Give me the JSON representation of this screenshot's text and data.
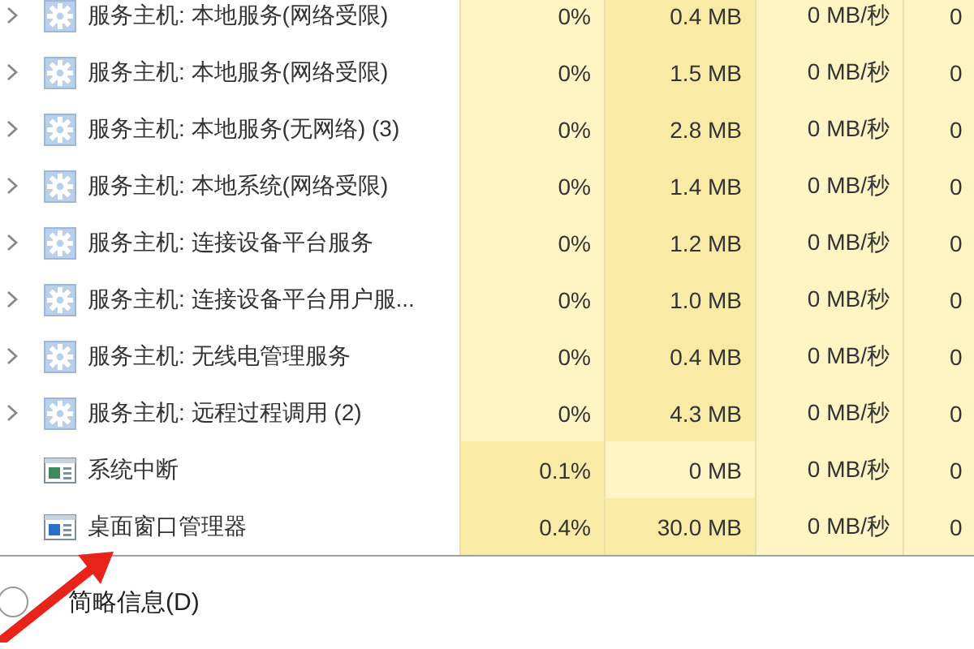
{
  "processes": [
    {
      "name": "服务主机: 本地服务(网络受限)",
      "kind": "service",
      "expandable": true,
      "cpu": {
        "text": "0%",
        "color": "#fff4c4"
      },
      "memory": {
        "text": "0.4 MB",
        "color": "#f9eba6"
      },
      "disk": {
        "text": "0 MB/秒",
        "color": "#fff4c4"
      },
      "column_5": {
        "text": "0",
        "color": "#fff4c4"
      }
    },
    {
      "name": "服务主机: 本地服务(网络受限)",
      "kind": "service",
      "expandable": true,
      "cpu": {
        "text": "0%",
        "color": "#fff4c4"
      },
      "memory": {
        "text": "1.5 MB",
        "color": "#f9eba6"
      },
      "disk": {
        "text": "0 MB/秒",
        "color": "#fff4c4"
      },
      "column_5": {
        "text": "0",
        "color": "#fff4c4"
      }
    },
    {
      "name": "服务主机: 本地服务(无网络) (3)",
      "kind": "service",
      "expandable": true,
      "cpu": {
        "text": "0%",
        "color": "#fff4c4"
      },
      "memory": {
        "text": "2.8 MB",
        "color": "#f9eba6"
      },
      "disk": {
        "text": "0 MB/秒",
        "color": "#fff4c4"
      },
      "column_5": {
        "text": "0",
        "color": "#fff4c4"
      }
    },
    {
      "name": "服务主机: 本地系统(网络受限)",
      "kind": "service",
      "expandable": true,
      "cpu": {
        "text": "0%",
        "color": "#fff4c4"
      },
      "memory": {
        "text": "1.4 MB",
        "color": "#f9eba6"
      },
      "disk": {
        "text": "0 MB/秒",
        "color": "#fff4c4"
      },
      "column_5": {
        "text": "0",
        "color": "#fff4c4"
      }
    },
    {
      "name": "服务主机: 连接设备平台服务",
      "kind": "service",
      "expandable": true,
      "cpu": {
        "text": "0%",
        "color": "#fff4c4"
      },
      "memory": {
        "text": "1.2 MB",
        "color": "#f9eba6"
      },
      "disk": {
        "text": "0 MB/秒",
        "color": "#fff4c4"
      },
      "column_5": {
        "text": "0",
        "color": "#fff4c4"
      }
    },
    {
      "name": "服务主机: 连接设备平台用户服...",
      "kind": "service",
      "expandable": true,
      "cpu": {
        "text": "0%",
        "color": "#fff4c4"
      },
      "memory": {
        "text": "1.0 MB",
        "color": "#f9eba6"
      },
      "disk": {
        "text": "0 MB/秒",
        "color": "#fff4c4"
      },
      "column_5": {
        "text": "0",
        "color": "#fff4c4"
      }
    },
    {
      "name": "服务主机: 无线电管理服务",
      "kind": "service",
      "expandable": true,
      "cpu": {
        "text": "0%",
        "color": "#fff4c4"
      },
      "memory": {
        "text": "0.4 MB",
        "color": "#f9eba6"
      },
      "disk": {
        "text": "0 MB/秒",
        "color": "#fff4c4"
      },
      "column_5": {
        "text": "0",
        "color": "#fff4c4"
      }
    },
    {
      "name": "服务主机: 远程过程调用 (2)",
      "kind": "service",
      "expandable": true,
      "cpu": {
        "text": "0%",
        "color": "#fff4c4"
      },
      "memory": {
        "text": "4.3 MB",
        "color": "#f9eba6"
      },
      "disk": {
        "text": "0 MB/秒",
        "color": "#fff4c4"
      },
      "column_5": {
        "text": "0",
        "color": "#fff4c4"
      }
    },
    {
      "name": "系统中断",
      "kind": "system",
      "expandable": false,
      "cpu": {
        "text": "0.1%",
        "color": "#f9eba6"
      },
      "memory": {
        "text": "0 MB",
        "color": "#fff4c4"
      },
      "disk": {
        "text": "0 MB/秒",
        "color": "#fff4c4"
      },
      "column_5": {
        "text": "0",
        "color": "#fff4c4"
      }
    },
    {
      "name": "桌面窗口管理器",
      "kind": "window",
      "expandable": false,
      "cpu": {
        "text": "0.4%",
        "color": "#f9eba6"
      },
      "memory": {
        "text": "30.0 MB",
        "color": "#f9eba6"
      },
      "disk": {
        "text": "0 MB/秒",
        "color": "#fff4c4"
      },
      "column_5": {
        "text": "0",
        "color": "#fff4c4"
      }
    }
  ],
  "footer": {
    "link": "简略信息(D)"
  }
}
